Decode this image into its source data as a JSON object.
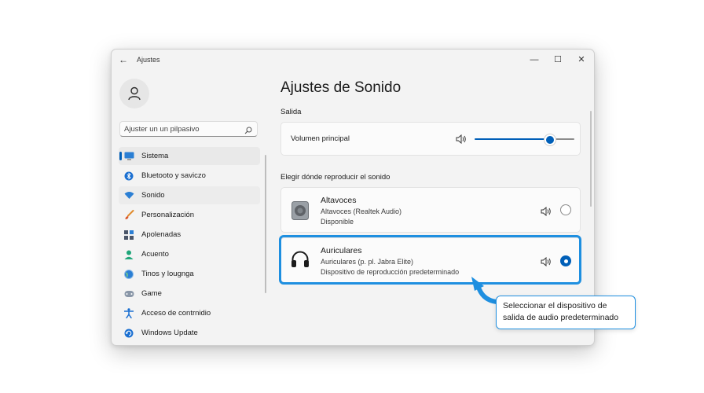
{
  "window": {
    "app_title": "Ajustes",
    "back_glyph": "←",
    "minimize_glyph": "—",
    "maximize_glyph": "☐",
    "close_glyph": "✕"
  },
  "search": {
    "placeholder": "Ajuster un un pilpasivo"
  },
  "sidebar": {
    "items": [
      {
        "label": "Sistema",
        "icon": "monitor-icon",
        "selected": true
      },
      {
        "label": "Bluetooto y saviczo",
        "icon": "bluetooth-icon"
      },
      {
        "label": "Sonido",
        "icon": "wifi-icon",
        "hover": true
      },
      {
        "label": "Personalización",
        "icon": "brush-icon"
      },
      {
        "label": "Apolenadas",
        "icon": "apps-icon"
      },
      {
        "label": "Acuento",
        "icon": "person-icon"
      },
      {
        "label": "Tinos y lougnga",
        "icon": "globe-icon"
      },
      {
        "label": "Game",
        "icon": "gamepad-icon"
      },
      {
        "label": "Acceso de contrnidio",
        "icon": "accessibility-icon"
      },
      {
        "label": "Windows Update",
        "icon": "update-icon"
      }
    ]
  },
  "main": {
    "title": "Ajustes de Sonido",
    "output_section": "Salida",
    "volume_label": "Volumen principal",
    "volume_level": 0.8,
    "choose_section": "Elegir dónde reproducir el sonido",
    "devices": [
      {
        "name": "Altavoces",
        "detail": "Altavoces (Realtek Audio)",
        "status": "Disponible",
        "selected": false,
        "icon": "speaker-device-icon"
      },
      {
        "name": "Auriculares",
        "detail": "Auriculares (p. pl. Jabra Elite)",
        "status": "Dispositivo de reproducción predeterminado",
        "selected": true,
        "icon": "headphones-icon"
      }
    ]
  },
  "annotation": {
    "callout_text": "Seleccionar el dispositivo de salida de audio predeterminado",
    "color": "#1e8fe0"
  },
  "colors": {
    "accent": "#005fb8",
    "window_bg": "#f3f3f3",
    "card_bg": "#fbfbfb"
  }
}
